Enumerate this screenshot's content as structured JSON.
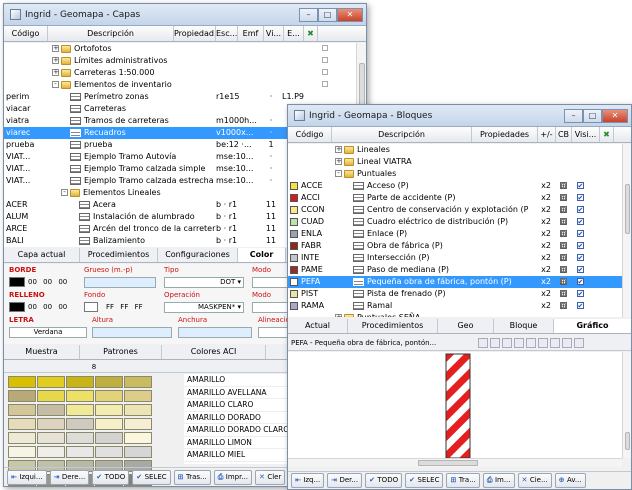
{
  "w1": {
    "title": "Ingrid - Geomapa - Capas",
    "headers": [
      "Código",
      "Descripción",
      "Propiedad...",
      "Esc...",
      "Emf",
      "Vi...",
      "E..."
    ],
    "rows": [
      {
        "code": "",
        "indent": 2,
        "pm": "+",
        "icon": "folder",
        "text": "Ortofotos",
        "prop": "",
        "esc": "",
        "emf": "",
        "sel": false
      },
      {
        "code": "",
        "indent": 2,
        "pm": "+",
        "icon": "folder",
        "text": "Límites administrativos",
        "prop": "",
        "esc": "",
        "emf": "",
        "sel": false
      },
      {
        "code": "",
        "indent": 2,
        "pm": "+",
        "icon": "folder",
        "text": "Carreteras 1:50.000",
        "prop": "",
        "esc": "",
        "emf": "",
        "sel": false
      },
      {
        "code": "",
        "indent": 2,
        "pm": "-",
        "icon": "folder",
        "text": "Elementos de inventario",
        "prop": "",
        "esc": "",
        "emf": "",
        "sel": false
      },
      {
        "code": "perim",
        "indent": 3,
        "pm": "",
        "icon": "layer",
        "text": "Perímetro zonas",
        "prop": "r1e15",
        "esc": "·",
        "emf": "L1.P9",
        "sel": false
      },
      {
        "code": "viacar",
        "indent": 3,
        "pm": "",
        "icon": "layer",
        "text": "Carreteras",
        "prop": "",
        "esc": "",
        "emf": "",
        "sel": false
      },
      {
        "code": "viatra",
        "indent": 3,
        "pm": "",
        "icon": "layer",
        "text": "Tramos de carreteras",
        "prop": "m1000h...",
        "esc": "·",
        "emf": "",
        "sel": false
      },
      {
        "code": "viarec",
        "indent": 3,
        "pm": "",
        "icon": "layer",
        "text": "Recuadros",
        "prop": "v1000x...",
        "esc": "·",
        "emf": "",
        "sel": true
      },
      {
        "code": "prueba",
        "indent": 3,
        "pm": "",
        "icon": "layer",
        "text": "prueba",
        "prop": "be:12 ·...",
        "esc": "1",
        "emf": "",
        "sel": false
      },
      {
        "code": "VIAT...",
        "indent": 3,
        "pm": "",
        "icon": "layer",
        "text": "Ejemplo Tramo Autovía",
        "prop": "mse:10...",
        "esc": "·",
        "emf": "",
        "sel": false
      },
      {
        "code": "VIAT...",
        "indent": 3,
        "pm": "",
        "icon": "layer",
        "text": "Ejemplo Tramo calzada simple",
        "prop": "mse:10...",
        "esc": "·",
        "emf": "",
        "sel": false
      },
      {
        "code": "VIAT...",
        "indent": 3,
        "pm": "",
        "icon": "layer",
        "text": "Ejemplo Tramo calzada estrecha",
        "prop": "mse:10...",
        "esc": "·",
        "emf": "",
        "sel": false
      },
      {
        "code": "",
        "indent": 3,
        "pm": "-",
        "icon": "folder",
        "text": "Elementos Lineales",
        "prop": "",
        "esc": "",
        "emf": "",
        "sel": false
      },
      {
        "code": "ACER",
        "indent": 4,
        "pm": "",
        "icon": "layer",
        "text": "Acera",
        "prop": "b · r1",
        "esc": "11",
        "emf": "",
        "sel": false
      },
      {
        "code": "ALUM",
        "indent": 4,
        "pm": "",
        "icon": "layer",
        "text": "Instalación de alumbrado",
        "prop": "b · r1",
        "esc": "11",
        "emf": "",
        "sel": false
      },
      {
        "code": "ARCE",
        "indent": 4,
        "pm": "",
        "icon": "layer",
        "text": "Arcén del tronco de la carretera",
        "prop": "b · r1",
        "esc": "11",
        "emf": "",
        "sel": false
      },
      {
        "code": "BALI",
        "indent": 4,
        "pm": "",
        "icon": "layer",
        "text": "Balizamiento",
        "prop": "b · r1",
        "esc": "11",
        "emf": "",
        "sel": false
      }
    ],
    "tabs": [
      "Capa actual",
      "Procedimientos",
      "Configuraciones",
      "Color",
      "Gr"
    ],
    "active_tab": "Color",
    "form": {
      "borde": "BORDE",
      "grueso": "Grueso (m.-p)",
      "tipo": "Tipo",
      "modo": "Modo",
      "borde_vals": [
        "00",
        "00",
        "00"
      ],
      "tipo_val": "DOT",
      "modo_val": "Redondeado",
      "relleno": "RELLENO",
      "fondo": "Fondo",
      "operacion": "Operación",
      "modo2": "Modo",
      "relleno_vals": [
        "00",
        "00",
        "00"
      ],
      "fondo_vals": [
        "FF",
        "FF",
        "FF"
      ],
      "operacion_val": "MASKPEN*",
      "modo2_val": "Alterno",
      "letra": "LETRA",
      "altura": "Altura",
      "anchura": "Anchura",
      "alineacion": "Alineación",
      "letra_val": "Verdana",
      "alineacion_val": "Cen-Cen"
    },
    "subtabs": [
      "Muestra",
      "Patrones",
      "Colores ACI",
      "Especiales"
    ],
    "list_header": {
      "num": "8",
      "desc": "Descripción"
    },
    "colors": [
      "AMARILLO",
      "AMARILLO AVELLANA",
      "AMARILLO CLARO",
      "AMARILLO DORADO",
      "AMARILLO DORADO CLARO",
      "AMARILLO LIMON",
      "AMARILLO MIEL"
    ],
    "buttons": [
      "Izqui...",
      "Dere...",
      "TODO",
      "SELEC",
      "Tras...",
      "Impr...",
      "Cler"
    ]
  },
  "w2": {
    "title": "Ingrid - Geomapa - Bloques",
    "headers": [
      "Código",
      "Descripción",
      "Propiedades",
      "+/-",
      "CB",
      "Visi..."
    ],
    "rows": [
      {
        "code": "",
        "color": "",
        "indent": 3,
        "pm": "+",
        "icon": "folder",
        "text": "Lineales",
        "prop": "",
        "sel": false
      },
      {
        "code": "",
        "color": "",
        "indent": 3,
        "pm": "+",
        "icon": "folder",
        "text": "Lineal VIATRA",
        "prop": "",
        "sel": false
      },
      {
        "code": "",
        "color": "",
        "indent": 3,
        "pm": "-",
        "icon": "folder",
        "text": "Puntuales",
        "prop": "",
        "sel": false
      },
      {
        "code": "ACCE",
        "color": "#f2e04a",
        "indent": 4,
        "pm": "",
        "icon": "block",
        "text": "Acceso (P)",
        "prop": "x2",
        "sel": false
      },
      {
        "code": "ACCI",
        "color": "#d01f1f",
        "indent": 4,
        "pm": "",
        "icon": "block",
        "text": "Parte de accidente (P)",
        "prop": "x2",
        "sel": false
      },
      {
        "code": "CCON",
        "color": "#f5eb8c",
        "indent": 4,
        "pm": "",
        "icon": "block",
        "text": "Centro de conservación y explotación (P)",
        "prop": "x2",
        "sel": false
      },
      {
        "code": "CUAD",
        "color": "#b9e6a8",
        "indent": 4,
        "pm": "",
        "icon": "block",
        "text": "Cuadro eléctrico de distribución (P)",
        "prop": "x2",
        "sel": false
      },
      {
        "code": "ENLA",
        "color": "#9aa3b2",
        "indent": 4,
        "pm": "",
        "icon": "block",
        "text": "Enlace (P)",
        "prop": "x2",
        "sel": false
      },
      {
        "code": "FABR",
        "color": "#8a2a1f",
        "indent": 4,
        "pm": "",
        "icon": "block",
        "text": "Obra de fábrica (P)",
        "prop": "x2",
        "sel": false
      },
      {
        "code": "INTE",
        "color": "#bfc6cf",
        "indent": 4,
        "pm": "",
        "icon": "block",
        "text": "Intersección (P)",
        "prop": "x2",
        "sel": false
      },
      {
        "code": "PAME",
        "color": "#9b2a2a",
        "indent": 4,
        "pm": "",
        "icon": "block",
        "text": "Paso de mediana (P)",
        "prop": "x2",
        "sel": false
      },
      {
        "code": "PEFA",
        "color": "#ffffff",
        "indent": 4,
        "pm": "",
        "icon": "block",
        "text": "Pequeña obra de fábrica, pontón (P)",
        "prop": "x2",
        "sel": true
      },
      {
        "code": "PIST",
        "color": "#e8e6a0",
        "indent": 4,
        "pm": "",
        "icon": "block",
        "text": "Pista de frenado (P)",
        "prop": "x2",
        "sel": false
      },
      {
        "code": "RAMA",
        "color": "#a7a7c9",
        "indent": 4,
        "pm": "",
        "icon": "block",
        "text": "Ramal",
        "prop": "x2",
        "sel": false
      },
      {
        "code": "",
        "color": "",
        "indent": 3,
        "pm": "+",
        "icon": "folder",
        "text": "Puntuales SEÑA",
        "prop": "",
        "sel": false
      }
    ],
    "tabs": [
      "Actual",
      "Procedimientos",
      "Geo",
      "Bloque",
      "Gráfico"
    ],
    "active_tab": "Gráfico",
    "preview_title": "PEFA - Pequeña obra de fábrica, pontón...",
    "buttons": [
      "Izq...",
      "Der...",
      "TODO",
      "SELEC",
      "Tra...",
      "Im...",
      "Cie...",
      "Av..."
    ]
  }
}
